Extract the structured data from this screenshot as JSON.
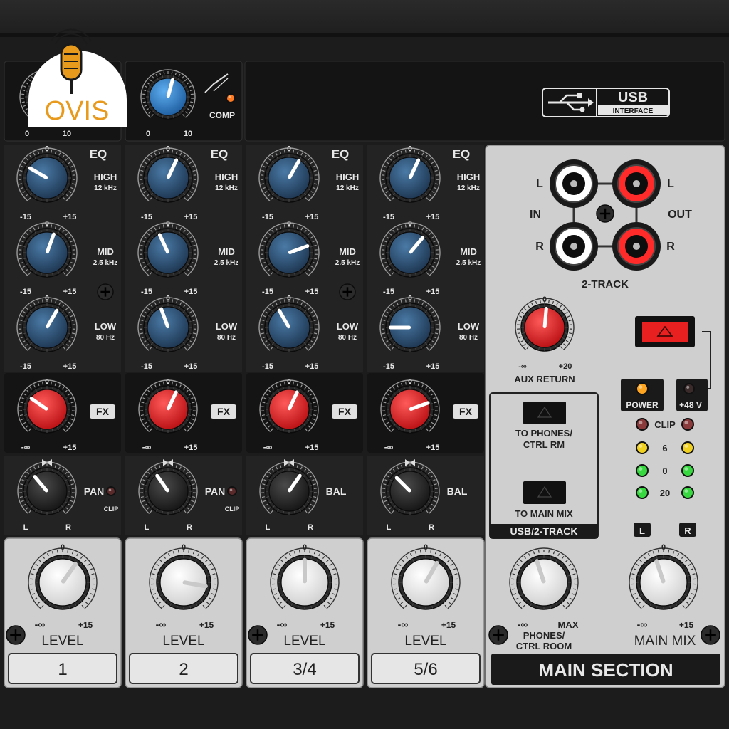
{
  "logo": {
    "brand": "OVIS"
  },
  "comp": {
    "label": "COMP",
    "scale_min": "0",
    "scale_max": "10"
  },
  "usb_badge": {
    "word": "USB",
    "sub": "INTERFACE"
  },
  "eq": {
    "title": "EQ",
    "bands": [
      {
        "name": "HIGH",
        "freq": "12 kHz"
      },
      {
        "name": "MID",
        "freq": "2.5 kHz"
      },
      {
        "name": "LOW",
        "freq": "80 Hz"
      }
    ],
    "center": "0",
    "min": "-15",
    "max": "+15"
  },
  "fx": {
    "label": "FX",
    "center": "0",
    "min": "-∞",
    "max": "+15"
  },
  "pan": {
    "pan_label": "PAN",
    "bal_label": "BAL",
    "clip_label": "CLIP",
    "left": "L",
    "right": "R"
  },
  "level": {
    "label": "LEVEL",
    "center": "0",
    "min": "-∞",
    "max": "+15"
  },
  "channels": [
    {
      "number": "1",
      "pan_type": "PAN",
      "has_comp": true,
      "has_clip": true
    },
    {
      "number": "2",
      "pan_type": "PAN",
      "has_comp": true,
      "has_clip": true
    },
    {
      "number": "3/4",
      "pan_type": "BAL",
      "has_comp": false,
      "has_clip": false
    },
    {
      "number": "5/6",
      "pan_type": "BAL",
      "has_comp": false,
      "has_clip": false
    }
  ],
  "main": {
    "two_track": {
      "in": "IN",
      "out": "OUT",
      "left": "L",
      "right": "R",
      "label": "2-TRACK"
    },
    "aux_return": {
      "label": "AUX RETURN",
      "center": "0",
      "min": "-∞",
      "max": "+20"
    },
    "power": "POWER",
    "phantom": "+48 V",
    "meter": [
      {
        "label": "CLIP",
        "color": "#8a3a3a"
      },
      {
        "label": "6",
        "color": "#f0d020"
      },
      {
        "label": "0",
        "color": "#38d840"
      },
      {
        "label": "20",
        "color": "#38d840"
      }
    ],
    "meter_left": "L",
    "meter_right": "R",
    "to_phones": "TO PHONES/",
    "ctrl_rm": "CTRL RM",
    "to_main_mix": "TO MAIN MIX",
    "usb_two_track": "USB/2-TRACK",
    "phones": {
      "label1": "PHONES/",
      "label2": "CTRL ROOM",
      "min": "-∞",
      "max": "MAX"
    },
    "main_mix": {
      "label": "MAIN MIX",
      "center": "0",
      "min": "-∞",
      "max": "+15"
    },
    "section_title": "MAIN SECTION"
  },
  "colors": {
    "eq_knob": "#2e4e6e",
    "fx_knob": "#e02828",
    "comp_knob": "#2f7fc8",
    "level_knob": "#f4f4f4",
    "led_orange": "#ff7a20"
  }
}
